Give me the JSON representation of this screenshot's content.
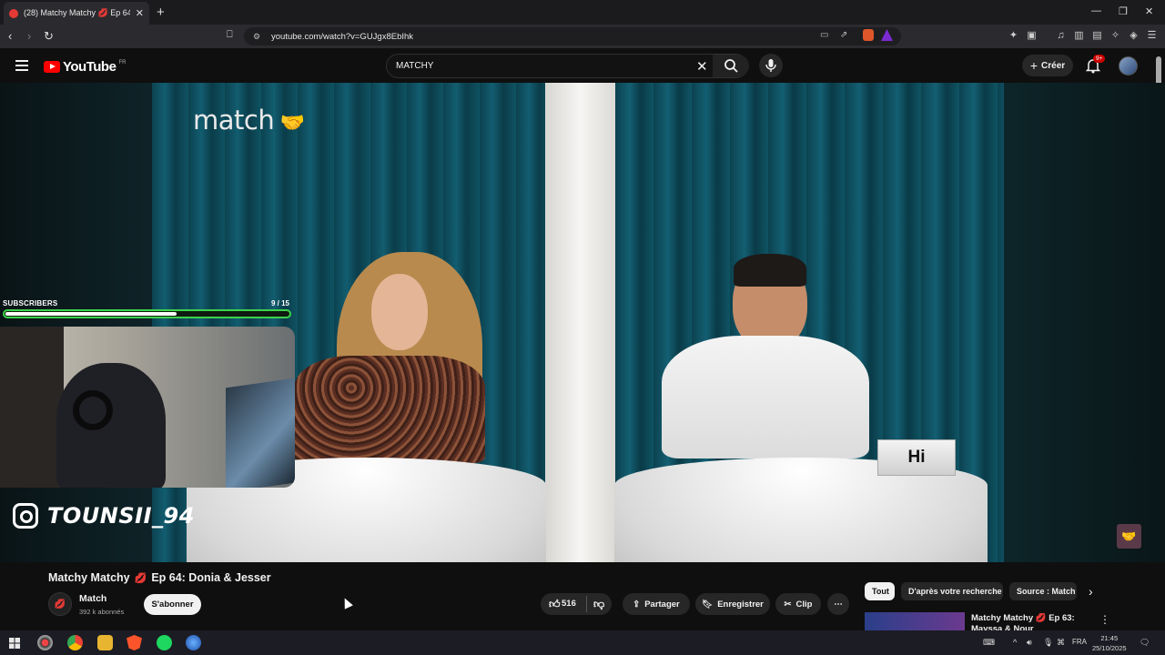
{
  "browser": {
    "tab_title": "(28) Matchy Matchy 💋 Ep 64: D",
    "url": "youtube.com/watch?v=GUJgx8EbIhk"
  },
  "youtube": {
    "logo": "YouTube",
    "country": "FR",
    "search_value": "MATCHY",
    "create_label": "Créer",
    "notif_count": "9+"
  },
  "overlay": {
    "subs_label": "SUBSCRIBERS",
    "subs_count": "9 / 15",
    "subs_progress": 0.6,
    "instagram_handle": "TOUNSII_94",
    "brand_logo": "match",
    "card_text": "Hi"
  },
  "video": {
    "title_prefix": "Matchy Matchy",
    "title_suffix": "Ep 64: Donia & Jesser",
    "channel": "Match",
    "subscribers": "392 k abonnés",
    "subscribe_label": "S'abonner",
    "likes": "516",
    "share_label": "Partager",
    "save_label": "Enregistrer",
    "clip_label": "Clip"
  },
  "chips": [
    "Tout",
    "D'après votre recherche",
    "Source : Match"
  ],
  "recommendation": {
    "title": "Matchy Matchy 💋 Ep 63: Mayssa & Nour"
  },
  "taskbar": {
    "lang": "FRA",
    "time": "21:45",
    "date": "25/10/2025"
  }
}
